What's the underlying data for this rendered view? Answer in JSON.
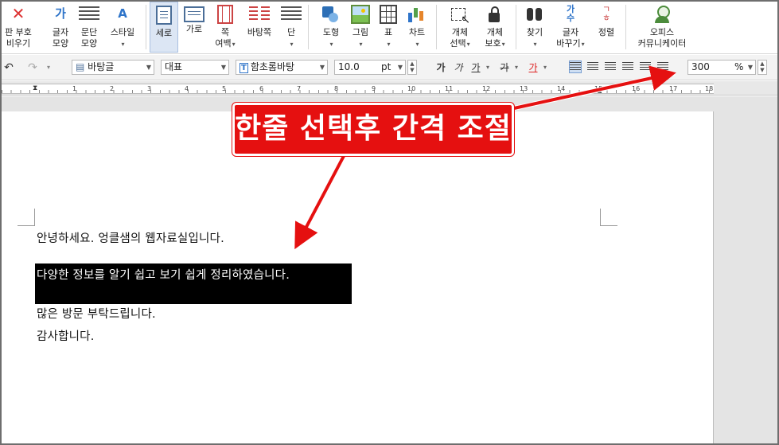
{
  "ribbon": {
    "char_symbol": {
      "line1": "판 부호",
      "line2": "비우기"
    },
    "char_shape": {
      "line1": "글자",
      "line2": "모양"
    },
    "para_shape": {
      "line1": "문단",
      "line2": "모양"
    },
    "style": {
      "line1": "스타일",
      "line2": ""
    },
    "portrait": {
      "line1": "세로"
    },
    "landscape": {
      "line1": "가로"
    },
    "margins": {
      "line1": "쪽",
      "line2": "여백"
    },
    "page_border": {
      "line1": "바탕쪽"
    },
    "columns": {
      "line1": "단"
    },
    "shape": {
      "line1": "도형"
    },
    "picture": {
      "line1": "그림"
    },
    "table": {
      "line1": "표"
    },
    "chart": {
      "line1": "차트"
    },
    "object_select": {
      "line1": "개체",
      "line2": "선택"
    },
    "object_protect": {
      "line1": "개체",
      "line2": "보호"
    },
    "find": {
      "line1": "찾기"
    },
    "replace": {
      "line1": "글자",
      "line2": "바꾸기"
    },
    "sort": {
      "line1": "정렬"
    },
    "office_communicator": {
      "line1": "오피스",
      "line2": "커뮤니케이터"
    },
    "replace_glyph": "가\n수",
    "sort_glyph": "ㄱ\nㅎ"
  },
  "format_bar": {
    "style_combo": "바탕글",
    "lang_combo": "대표",
    "font_combo": "함초롬바탕",
    "font_prefix": "T",
    "size_value": "10.0",
    "size_unit": "pt",
    "bold": "가",
    "italic": "가",
    "underline": "가",
    "strike": "가",
    "color": "가",
    "line_spacing_value": "300",
    "line_spacing_unit": "%"
  },
  "ruler": {
    "numbers": [
      "1",
      "2",
      "3",
      "4",
      "5",
      "6",
      "7",
      "8",
      "9",
      "10",
      "11",
      "12",
      "13",
      "14",
      "15",
      "16",
      "17",
      "18"
    ]
  },
  "document": {
    "lines": [
      "안녕하세요. 엉클샘의 웹자료실입니다.",
      "다양한 정보를 알기 쉽고 보기 쉽게 정리하였습니다.",
      "많은 방문 부탁드립니다.",
      "감사합니다."
    ]
  },
  "annotation": {
    "callout_text": "한줄 선택후 간격 조절",
    "arrow_color": "#e51010"
  }
}
